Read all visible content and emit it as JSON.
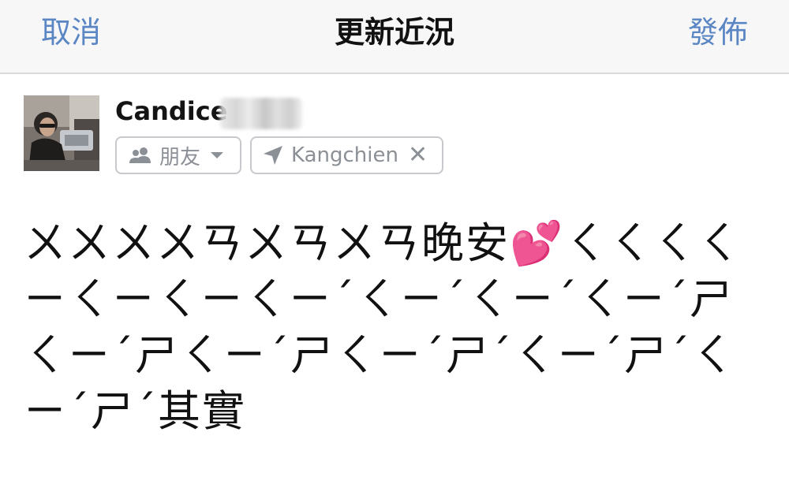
{
  "nav": {
    "cancel_label": "取消",
    "title": "更新近況",
    "post_label": "發佈"
  },
  "composer": {
    "user": {
      "name": "Candice",
      "avatar_icon": "profile-photo"
    },
    "audience": {
      "icon": "friends-icon",
      "label": "朋友"
    },
    "location": {
      "icon": "location-arrow-icon",
      "label": "Kangchien",
      "remove": "✕"
    },
    "text": "ㄨㄨㄨㄨㄢㄨㄢㄨㄢ晚安💕ㄑㄑㄑㄑㄧㄑㄧㄑㄧㄑㄧˊㄑㄧˊㄑㄧˊㄑㄧˊㄕㄑㄧˊㄕㄑㄧˊㄕㄑㄧˊㄕˊㄑㄧˊㄕˊㄑㄧˊㄕˊ其實"
  },
  "colors": {
    "accent": "#5b86c4",
    "nav_bg": "#f7f7f8",
    "chip_border": "#c7c9cd",
    "chip_text": "#8b8f96"
  }
}
